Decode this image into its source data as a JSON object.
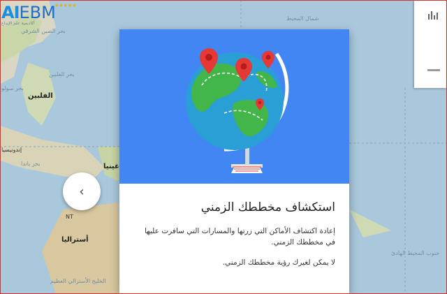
{
  "logo": {
    "text_ai": "AI",
    "text_ebm": "EBM",
    "stars": "★★★★★",
    "subtitle": "أكاديمية علم الإبداع"
  },
  "map": {
    "labels": {
      "north_pacific": "شمال المحيط",
      "east_china_sea": "بحر الصين الشرقي",
      "philippine_sea": "بحر الفلبين",
      "philippines": "الفلبين",
      "sulu": "بحر سولو",
      "indonesia": "إندونيسيا",
      "banda": "بحر باندا",
      "guinea": "غينيا",
      "nt": "NT",
      "australia": "أستراليا",
      "south_pacific": "جنوب المحيط الهادئ",
      "great_bight": "الخليج الأسترالي العظيم"
    }
  },
  "side_panel": {
    "icon": "bar-chart-icon"
  },
  "prev_button": {
    "glyph": "‹",
    "icon": "chevron-left-icon"
  },
  "dialog": {
    "title": "استكشاف مخططك الزمني",
    "body1": "إعادة اكتشاف الأماكن التي زرتها والمسارات التي سافرت عليها في مخططك الزمني.",
    "body2": "لا يمكن لغيرك رؤية مخططك الزمني.",
    "hero_color": "#4286f4",
    "illustration": "globe-with-pins-icon"
  }
}
